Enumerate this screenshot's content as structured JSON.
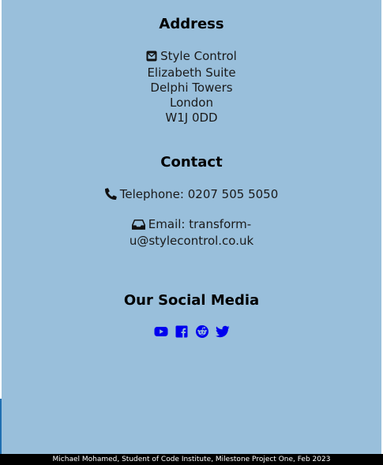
{
  "address": {
    "heading": "Address",
    "icon": "envelope-square-icon",
    "lines": [
      "Style Control",
      "Elizabeth Suite",
      "Delphi Towers",
      "London",
      "W1J 0DD"
    ]
  },
  "contact": {
    "heading": "Contact",
    "phone": {
      "icon": "phone-icon",
      "text": "Telephone: 0207 505 5050"
    },
    "email": {
      "icon": "inbox-icon",
      "text": "Email: transform-u@stylecontrol.co.uk"
    }
  },
  "social": {
    "heading": "Our Social Media",
    "links": [
      {
        "icon": "youtube-icon"
      },
      {
        "icon": "facebook-icon"
      },
      {
        "icon": "reddit-icon"
      },
      {
        "icon": "twitter-icon"
      }
    ]
  },
  "footer": {
    "text": "Michael Mohamed, Student of Code Institute, Milestone Project One, Feb 2023"
  },
  "colors": {
    "panel_background": "#99bfdb",
    "social_icon": "#0000ee",
    "footer_background": "#000000",
    "footer_text": "#ffffff"
  }
}
